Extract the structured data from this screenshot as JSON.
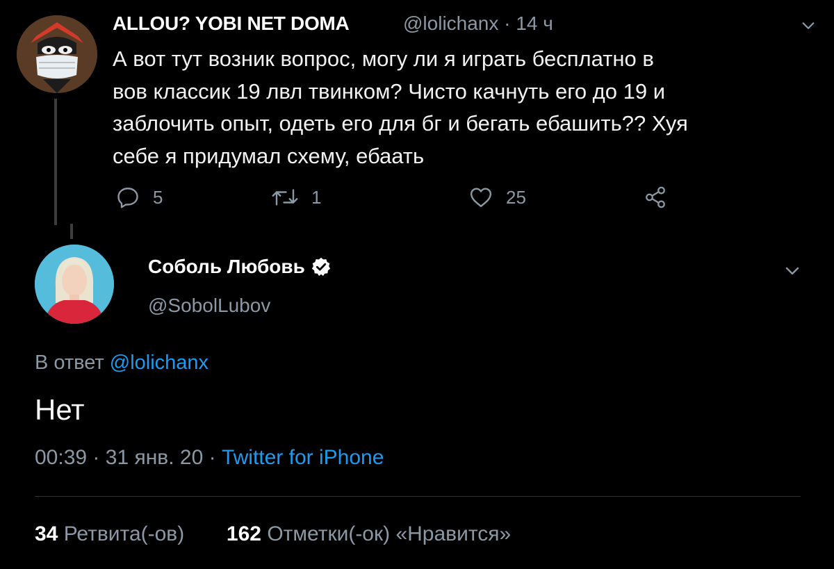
{
  "parent_tweet": {
    "display_name": "ALLOU? YOBI NET DOMA",
    "handle": "@lolichanx",
    "separator": "·",
    "time_ago": "14 ч",
    "text": "А вот тут возник вопрос, могу ли я играть бесплатно в\nвов классик 19 лвл твинком? Чисто качнуть его до 19 и\nзаблочить опыт, одеть его для бг и бегать ебашить?? Хуя\nсебе я придумал схему, ебаать",
    "replies_count": "5",
    "retweets_count": "1",
    "likes_count": "25",
    "icons": {
      "reply": "reply-icon",
      "retweet": "retweet-icon",
      "like": "heart-icon",
      "share": "share-icon",
      "menu": "chevron-down-icon"
    }
  },
  "reply_tweet": {
    "display_name": "Соболь Любовь",
    "handle": "@SobolLubov",
    "reply_prefix": "В ответ",
    "reply_mention": "@lolichanx",
    "text": "Нет",
    "time": "00:39",
    "sep1": "·",
    "date": "31 янв. 20",
    "sep2": "·",
    "source": "Twitter for iPhone",
    "retweets_num": "34",
    "retweets_label": "Ретвита(-ов)",
    "likes_num": "162",
    "likes_label": "Отметки(-ок) «Нравится»",
    "icons": {
      "verified": "verified-badge-icon",
      "menu": "chevron-down-icon"
    }
  },
  "colors": {
    "background": "#000000",
    "text": "#ffffff",
    "secondary": "#8b98a5",
    "link": "#1d9bf0",
    "thread_line": "#3d3d3d"
  }
}
